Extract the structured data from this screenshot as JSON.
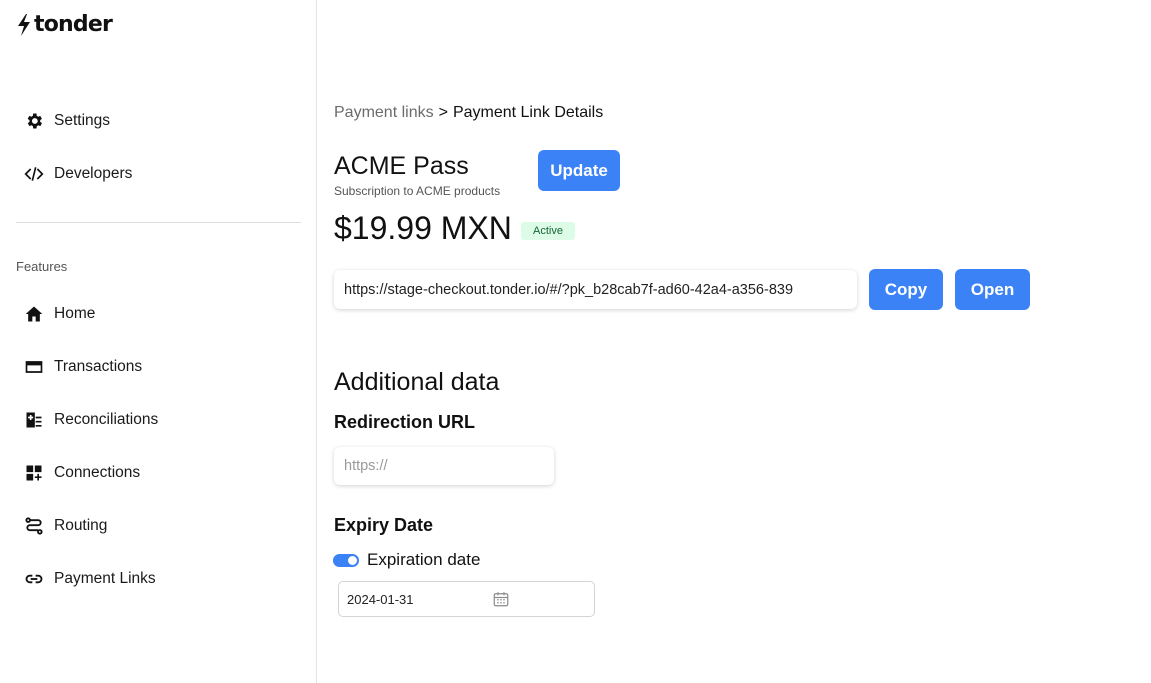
{
  "brand": {
    "name": "tonder"
  },
  "sidebar": {
    "top_items": [
      {
        "label": "Settings",
        "icon": "gear-icon"
      },
      {
        "label": "Developers",
        "icon": "code-icon"
      }
    ],
    "section_label": "Features",
    "items": [
      {
        "label": "Home",
        "icon": "home-icon"
      },
      {
        "label": "Transactions",
        "icon": "card-icon"
      },
      {
        "label": "Reconciliations",
        "icon": "reconcile-icon"
      },
      {
        "label": "Connections",
        "icon": "connections-icon"
      },
      {
        "label": "Routing",
        "icon": "routing-icon"
      },
      {
        "label": "Payment Links",
        "icon": "link-icon"
      }
    ]
  },
  "breadcrumb": {
    "parent": "Payment links",
    "separator": ">",
    "current": "Payment Link Details"
  },
  "payment_link": {
    "title": "ACME Pass",
    "subtitle": "Subscription to ACME products",
    "update_label": "Update",
    "price": "$19.99 MXN",
    "status": "Active",
    "url": "https://stage-checkout.tonder.io/#/?pk_b28cab7f-ad60-42a4-a356-839",
    "copy_label": "Copy",
    "open_label": "Open"
  },
  "additional": {
    "heading": "Additional data",
    "redirect_heading": "Redirection URL",
    "redirect_placeholder": "https://",
    "expiry_heading": "Expiry Date",
    "expiration_toggle_label": "Expiration date",
    "expiration_enabled": true,
    "expiry_date": "2024-01-31"
  },
  "colors": {
    "accent": "#3b82f6",
    "badge_bg": "#dcfce7",
    "badge_text": "#166534"
  }
}
